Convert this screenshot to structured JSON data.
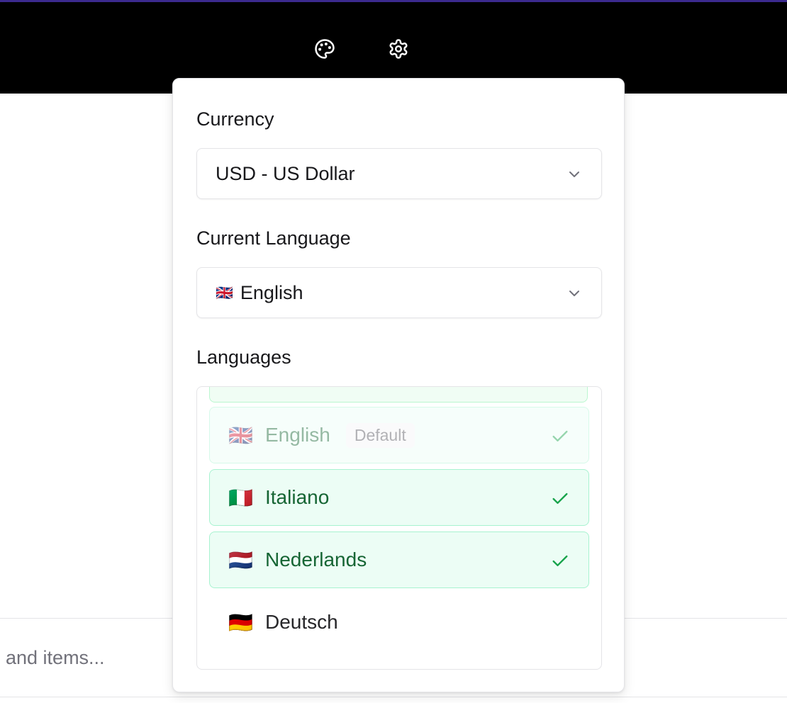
{
  "header": {
    "icons": [
      {
        "name": "palette-icon"
      },
      {
        "name": "gear-icon"
      }
    ]
  },
  "search": {
    "placeholder": "and items..."
  },
  "settings_popover": {
    "currency": {
      "label": "Currency",
      "selected": "USD - US Dollar"
    },
    "current_language": {
      "label": "Current Language",
      "flag": "🇬🇧",
      "selected": "English"
    },
    "languages": {
      "label": "Languages",
      "items": [
        {
          "flag": "🇬🇧",
          "name": "English",
          "badge": "Default",
          "checked": true,
          "disabled": true
        },
        {
          "flag": "🇮🇹",
          "name": "Italiano",
          "checked": true
        },
        {
          "flag": "🇳🇱",
          "name": "Nederlands",
          "checked": true
        },
        {
          "flag": "🇩🇪",
          "name": "Deutsch",
          "checked": false
        }
      ]
    }
  },
  "colors": {
    "topbar": "#000000",
    "selected_bg": "#ecfdf5",
    "selected_border": "#a7f3d0",
    "selected_text": "#166534",
    "check": "#16a34a"
  }
}
